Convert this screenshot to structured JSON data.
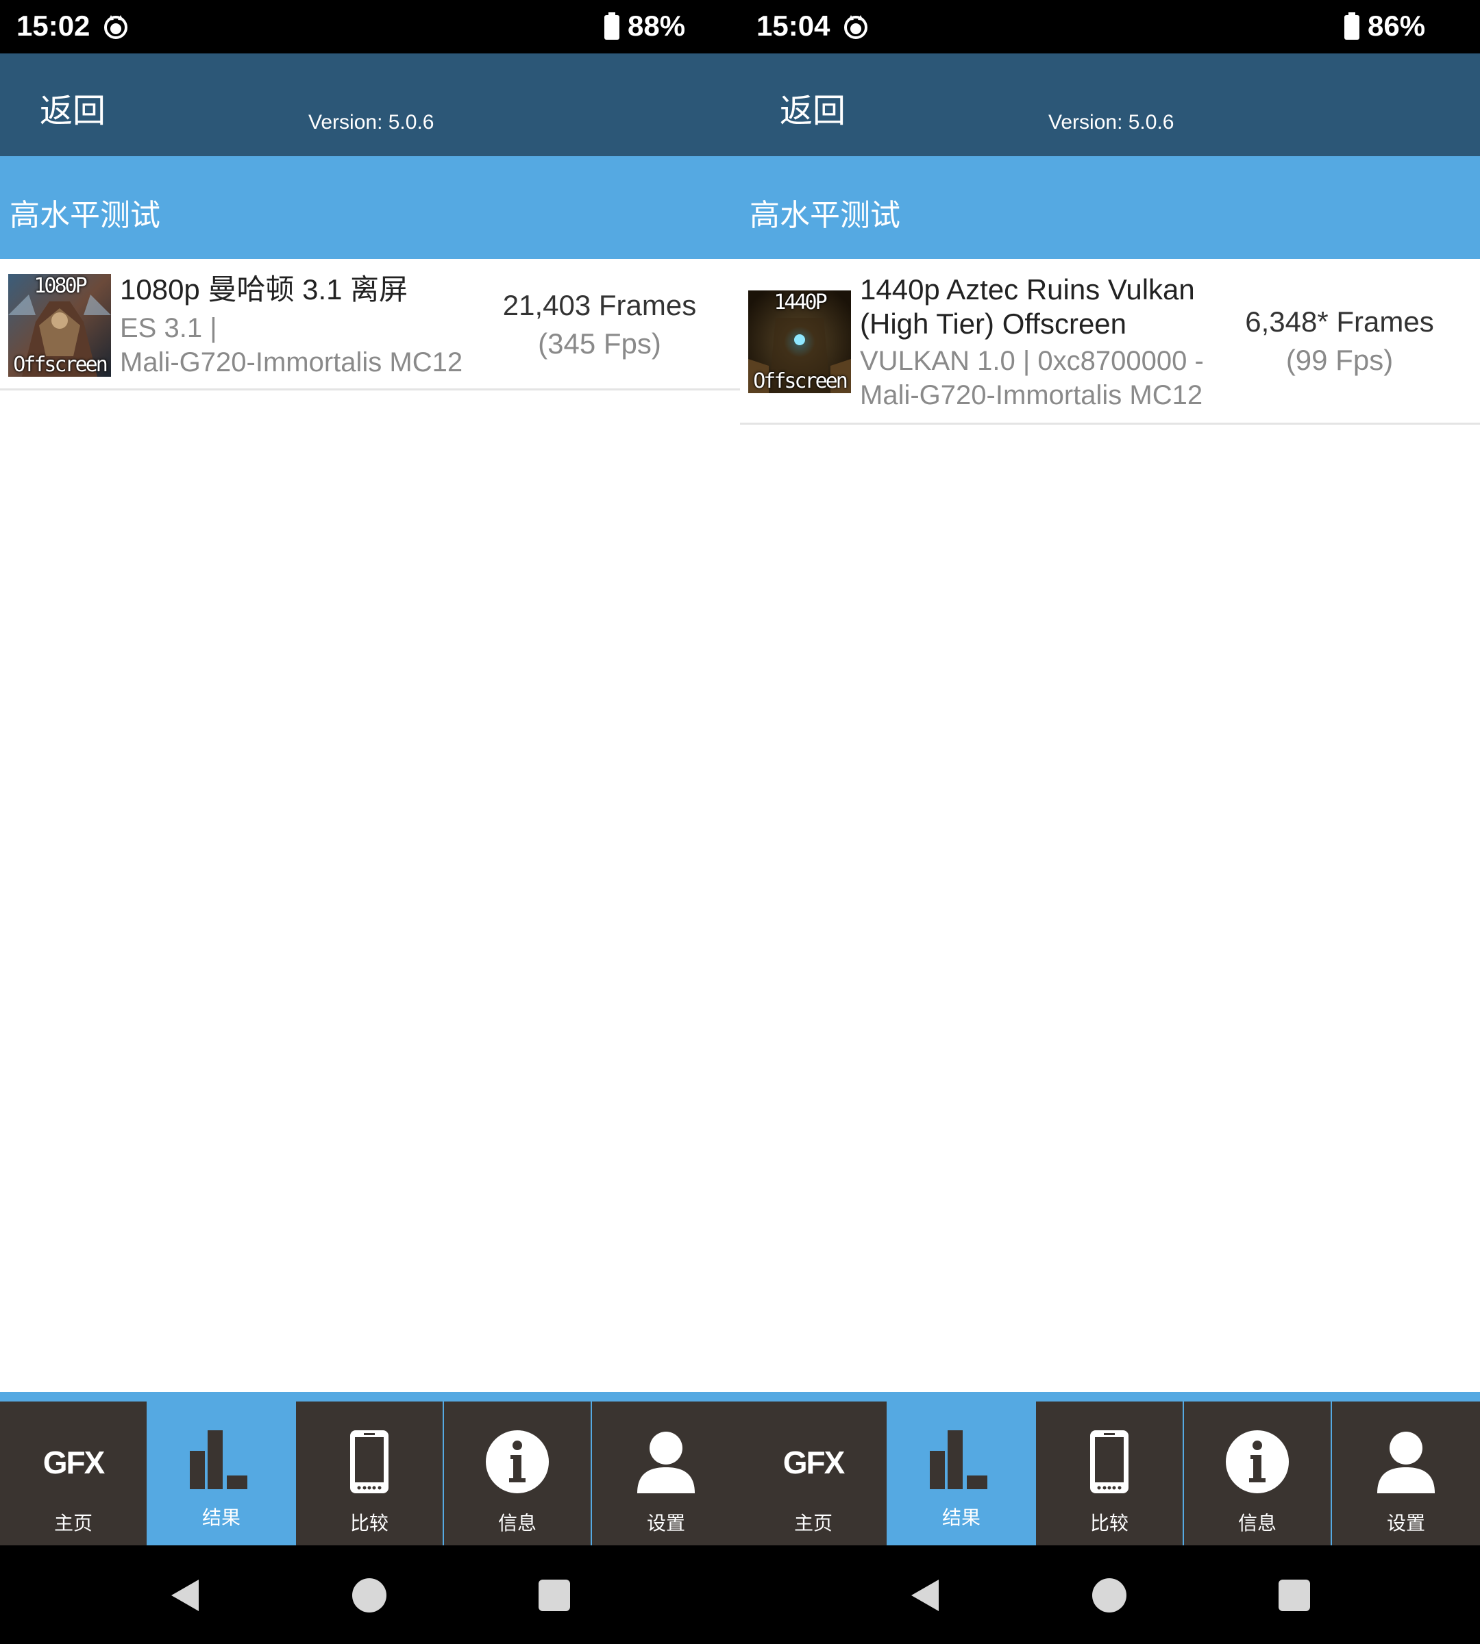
{
  "screens": [
    {
      "status": {
        "time": "15:02",
        "battery": "88%"
      },
      "header": {
        "back_label": "返回",
        "version": "Version: 5.0.6"
      },
      "section_title": "高水平测试",
      "result": {
        "thumb_res": "1080P",
        "thumb_off": "Offscreen",
        "title": "1080p 曼哈顿 3.1 离屏",
        "sub_line1": "ES 3.1 |",
        "sub_line2": "Mali-G720-Immortalis MC12",
        "frames": "21,403 Frames",
        "fps": "(345 Fps)"
      },
      "tabs": [
        {
          "label": "主页",
          "icon": "gfx-logo",
          "text": "GFX"
        },
        {
          "label": "结果",
          "icon": "bar-chart-icon"
        },
        {
          "label": "比较",
          "icon": "phone-icon"
        },
        {
          "label": "信息",
          "icon": "info-icon"
        },
        {
          "label": "设置",
          "icon": "user-icon"
        }
      ]
    },
    {
      "status": {
        "time": "15:04",
        "battery": "86%"
      },
      "header": {
        "back_label": "返回",
        "version": "Version: 5.0.6"
      },
      "section_title": "高水平测试",
      "result": {
        "thumb_res": "1440P",
        "thumb_off": "Offscreen",
        "title_line1": "1440p Aztec Ruins Vulkan",
        "title_line2": "(High Tier) Offscreen",
        "sub_line1": "VULKAN 1.0 | 0xc8700000 -",
        "sub_line2": "Mali-G720-Immortalis MC12",
        "frames": "6,348* Frames",
        "fps": "(99 Fps)"
      },
      "tabs": [
        {
          "label": "主页",
          "icon": "gfx-logo",
          "text": "GFX"
        },
        {
          "label": "结果",
          "icon": "bar-chart-icon"
        },
        {
          "label": "比较",
          "icon": "phone-icon"
        },
        {
          "label": "信息",
          "icon": "info-icon"
        },
        {
          "label": "设置",
          "icon": "user-icon"
        }
      ]
    }
  ],
  "active_tab": "结果",
  "colors": {
    "header": "#2c5777",
    "section": "#55a9e2",
    "tab_bg": "#3a3430",
    "tab_active": "#55a9e2"
  }
}
